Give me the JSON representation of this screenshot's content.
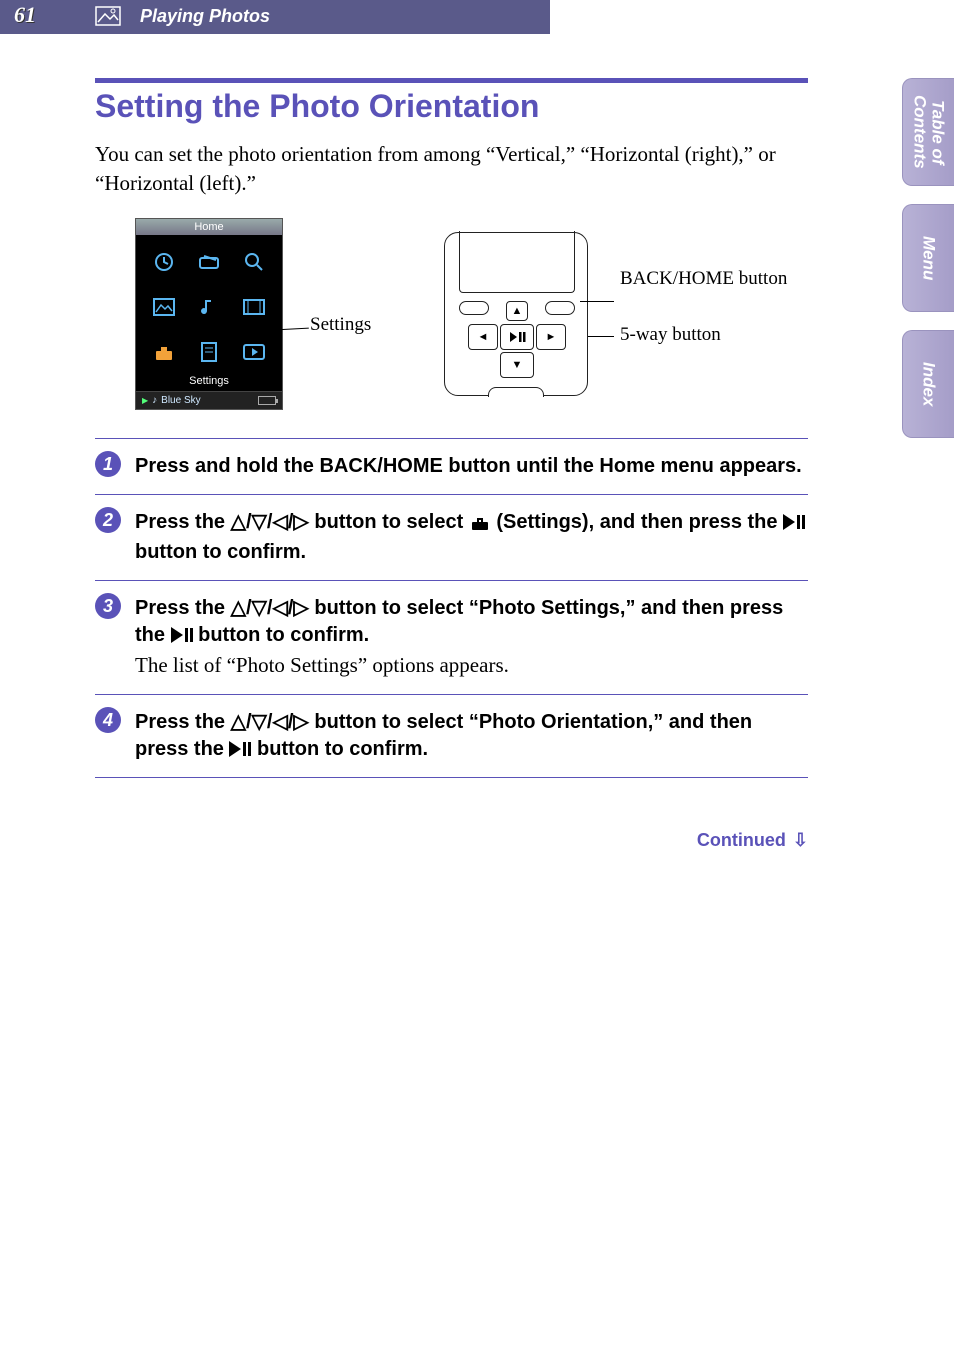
{
  "page_number": "61",
  "chapter": "Playing Photos",
  "side_tabs": {
    "toc": "Table of\nContents",
    "menu": "Menu",
    "index": "Index"
  },
  "title": "Setting the Photo Orientation",
  "intro": "You can set the photo orientation from among “Vertical,” “Horizontal (right),” or “Horizontal (left).”",
  "menu_shot": {
    "top_label": "Home",
    "highlight_label": "Settings",
    "now_playing": "Blue Sky"
  },
  "callouts": {
    "settings": "Settings",
    "back_home": "BACK/HOME button",
    "fiveway": "5-way button"
  },
  "steps": [
    {
      "n": "1",
      "head": "Press and hold the BACK/HOME button until the Home menu appears."
    },
    {
      "n": "2",
      "head_a": "Press the ",
      "head_b": " button to select ",
      "head_c": " (Settings), and then press the ",
      "head_d": " button to confirm."
    },
    {
      "n": "3",
      "head_a": "Press the ",
      "head_b": " button to select “Photo Settings,” and then press the ",
      "head_c": " button to confirm.",
      "sub": "The list of “Photo Settings” options appears."
    },
    {
      "n": "4",
      "head_a": "Press the ",
      "head_b": " button to select “Photo Orientation,” and then press the ",
      "head_c": " button to confirm."
    }
  ],
  "dpad_glyphs": "△/▽/◁/▷",
  "continued": "Continued"
}
